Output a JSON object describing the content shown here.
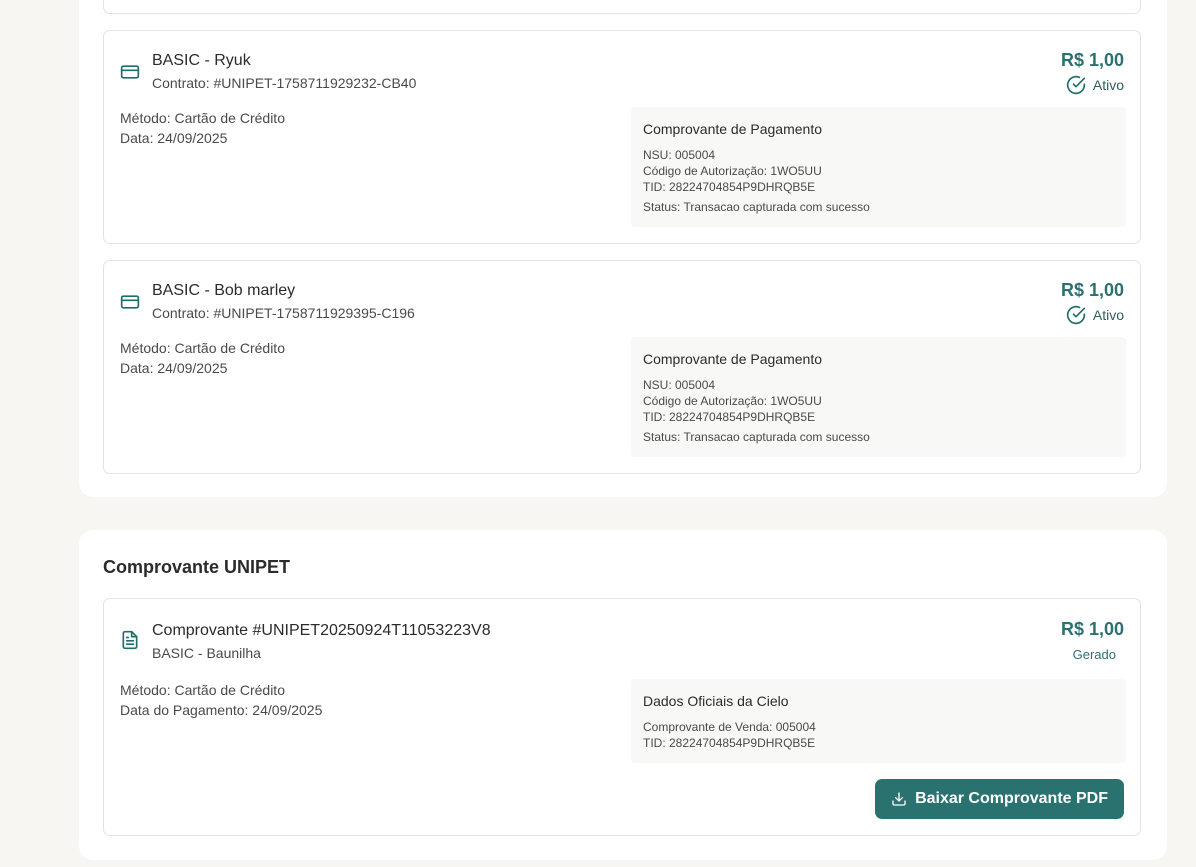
{
  "subscriptions": [
    {
      "plan_title": "BASIC - Ryuk",
      "contract": "Contrato: #UNIPET-1758711929232-CB40",
      "amount": "R$ 1,00",
      "status": "Ativo",
      "method": "Método: Cartão de Crédito",
      "date": "Data: 24/09/2025",
      "receipt": {
        "title": "Comprovante de Pagamento",
        "nsu": "NSU: 005004",
        "auth_code": "Código de Autorização: 1WO5UU",
        "tid": "TID: 28224704854P9DHRQB5E",
        "status": "Status: Transacao capturada com sucesso"
      },
      "icon": "credit-card-icon"
    },
    {
      "plan_title": "BASIC - Bob marley",
      "contract": "Contrato: #UNIPET-1758711929395-C196",
      "amount": "R$ 1,00",
      "status": "Ativo",
      "method": "Método: Cartão de Crédito",
      "date": "Data: 24/09/2025",
      "receipt": {
        "title": "Comprovante de Pagamento",
        "nsu": "NSU: 005004",
        "auth_code": "Código de Autorização: 1WO5UU",
        "tid": "TID: 28224704854P9DHRQB5E",
        "status": "Status: Transacao capturada com sucesso"
      },
      "icon": "credit-card-icon"
    }
  ],
  "unipet_receipt": {
    "section_title": "Comprovante UNIPET",
    "title": "Comprovante #UNIPET20250924T11053223V8",
    "subtitle": "BASIC - Baunilha",
    "amount": "R$ 1,00",
    "status": "Gerado",
    "method": "Método: Cartão de Crédito",
    "payment_date": "Data do Pagamento: 24/09/2025",
    "cielo": {
      "title": "Dados Oficiais da Cielo",
      "sale_receipt": "Comprovante de Venda: 005004",
      "tid": "TID: 28224704854P9DHRQB5E"
    },
    "download_label": "Baixar Comprovante PDF",
    "icon": "document-icon"
  },
  "colors": {
    "accent": "#2a7270",
    "background": "#f7f6f3",
    "card_border": "#e3e3e3",
    "receipt_bg": "#f8f8f7"
  }
}
